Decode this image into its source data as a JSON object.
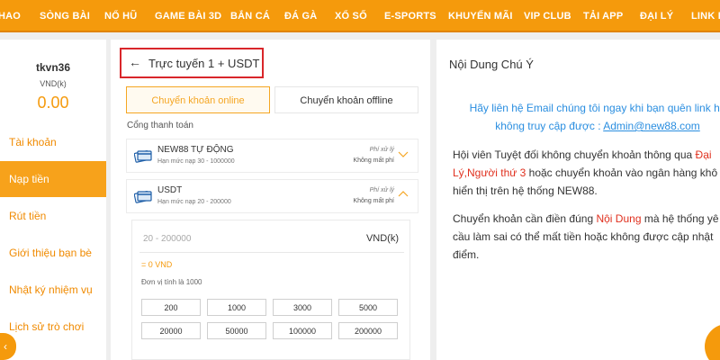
{
  "nav": {
    "items": [
      "HAO",
      "SÒNG BÀI",
      "NỔ HŨ",
      "GAME BÀI 3D",
      "BẮN CÁ",
      "ĐÁ GÀ",
      "XỔ SỐ",
      "E-SPORTS",
      "KHUYẾN MÃI",
      "VIP CLUB",
      "TẢI APP",
      "ĐẠI LÝ",
      "LINK DỰ"
    ]
  },
  "account": {
    "username": "tkvn36",
    "currency": "VND(k)",
    "balance": "0.00"
  },
  "sidebar": {
    "items": [
      {
        "label": "Tài khoản"
      },
      {
        "label": "Nạp tiền"
      },
      {
        "label": "Rút tiền"
      },
      {
        "label": "Giới thiệu bạn bè"
      },
      {
        "label": "Nhật ký nhiệm vụ"
      },
      {
        "label": "Lịch sử trò chơi"
      }
    ],
    "arrow": "‹"
  },
  "deposit": {
    "back": "←",
    "title": "Trực tuyến 1 + USDT",
    "tabs": [
      "Chuyển khoản online",
      "Chuyển khoản offline"
    ],
    "section_label": "Cổng thanh toán",
    "methods": [
      {
        "name": "NEW88 TỰ ĐỘNG",
        "limit": "Hạn mức nạp 30 - 1000000",
        "fee_label": "Phí xử lý",
        "fee_value": "Không mất phí"
      },
      {
        "name": "USDT",
        "limit": "Hạn mức nạp 20 - 200000",
        "fee_label": "Phí xử lý",
        "fee_value": "Không mất phí"
      }
    ],
    "amount": {
      "placeholder": "20 - 200000",
      "currency": "VND(k)",
      "equals": "= 0 VND",
      "unit_note": "Đơn vị tính là 1000",
      "chips": [
        "200",
        "1000",
        "3000",
        "5000",
        "20000",
        "50000",
        "100000",
        "200000"
      ]
    }
  },
  "notice": {
    "title": "Nội Dung Chú Ý",
    "blue_line1": "Hãy liên hệ Email chúng tôi ngay khi bạn quên link ho",
    "blue_line2_prefix": "không truy cập được : ",
    "email": "Admin@new88.com",
    "p1_line1_a": "Hội viên Tuyệt đối không chuyển khoản thông qua ",
    "p1_line1_red": "Đại",
    "p1_line2_red": "Lý,Người thứ 3",
    "p1_line2_b": " hoặc chuyển khoản vào ngân hàng khô",
    "p1_line3": "hiển thị trên hệ thống NEW88.",
    "p2_line1_a": "Chuyển khoản cần điền đúng ",
    "p2_line1_red": "Nội Dung",
    "p2_line1_b": " mà hệ thống yê",
    "p2_line2": "cầu làm sai có thể mất tiền hoặc không được cập nhật",
    "p2_line3": "điểm."
  },
  "colors": {
    "brand_orange": "#f59a0c",
    "alert_red": "#d9262a",
    "link_blue": "#2a8ee0"
  }
}
